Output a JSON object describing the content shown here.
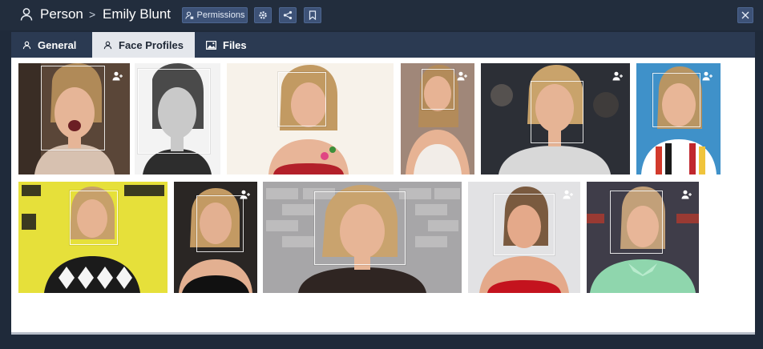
{
  "window": {
    "breadcrumb_root": "Person",
    "breadcrumb_separator": ">",
    "person_name": "Emily Blunt",
    "permissions_label": "Permissions",
    "icons": {
      "person": "person-icon",
      "permissions": "user-lock-icon",
      "settings": "gear-icon",
      "share": "share-icon",
      "bookmark": "bookmark-icon",
      "close": "close-icon"
    },
    "colors": {
      "titlebar": "#222d3d",
      "tabstrip": "#2b3a52",
      "active_tab": "#e4e7ec",
      "accent_button": "#3d5277"
    }
  },
  "tabs": [
    {
      "label": "General",
      "icon": "person-icon",
      "active": false
    },
    {
      "label": "Face Profiles",
      "icon": "person-icon",
      "active": true
    },
    {
      "label": "Files",
      "icon": "image-icon",
      "active": false
    }
  ],
  "face_profiles": [
    {
      "row": 1,
      "index": 1,
      "bg": "#5a4638",
      "hair": "#b08a58",
      "outfit": "#d7c1b0"
    },
    {
      "row": 1,
      "index": 2,
      "bg": "#f3f3f3",
      "hair": "#4a4a4a",
      "outfit": "#2d2d2d"
    },
    {
      "row": 1,
      "index": 3,
      "bg": "#f7f2ea",
      "hair": "#c29a62",
      "outfit": "#b3202a"
    },
    {
      "row": 1,
      "index": 4,
      "bg": "#a08779",
      "hair": "#b38b5a",
      "outfit": "#f2ede8"
    },
    {
      "row": 1,
      "index": 5,
      "bg": "#2c2f36",
      "hair": "#c9a36b",
      "outfit": "#d8d8d8"
    },
    {
      "row": 1,
      "index": 6,
      "bg": "#3f91c9",
      "hair": "#b89563",
      "outfit": "#ffffff"
    },
    {
      "row": 2,
      "index": 1,
      "bg": "#e6e03a",
      "hair": "#c7a06a",
      "outfit": "#1b1b1b"
    },
    {
      "row": 2,
      "index": 2,
      "bg": "#2a2624",
      "hair": "#c39a63",
      "outfit": "#111111"
    },
    {
      "row": 2,
      "index": 3,
      "bg": "#a7a6a8",
      "hair": "#c9a36e",
      "outfit": "#2f2522"
    },
    {
      "row": 2,
      "index": 4,
      "bg": "#e2e2e4",
      "hair": "#7a5a3f",
      "outfit": "#c4131e"
    },
    {
      "row": 2,
      "index": 5,
      "bg": "#3f3d49",
      "hair": "#c2a079",
      "outfit": "#8fd6ad"
    }
  ]
}
